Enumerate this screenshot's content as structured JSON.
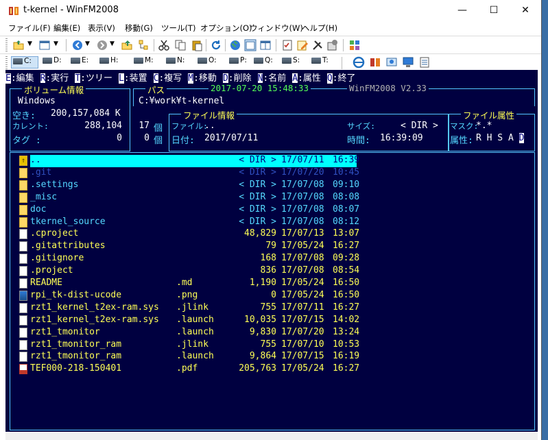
{
  "window": {
    "title": "t-kernel - WinFM2008",
    "min": "—",
    "max": "☐",
    "close": "✕"
  },
  "menu": [
    "ファイル(F)",
    "編集(E)",
    "表示(V)",
    "移動(G)",
    "ツール(T)",
    "オプション(O)",
    "ウィンドウ(W)",
    "ヘルプ(H)"
  ],
  "drives": [
    "C:",
    "D:",
    "E:",
    "H:",
    "M:",
    "N:",
    "O:",
    "P:",
    "Q:",
    "S:",
    "T:"
  ],
  "commands": [
    {
      "key": "E",
      "label": ":編集"
    },
    {
      "key": "R",
      "label": ":実行"
    },
    {
      "key": "T",
      "label": ":ツリー"
    },
    {
      "key": "L",
      "label": ":装置"
    },
    {
      "key": "C",
      "label": ":複写"
    },
    {
      "key": "M",
      "label": ":移動"
    },
    {
      "key": "D",
      "label": ":削除"
    },
    {
      "key": "N",
      "label": ":名前"
    },
    {
      "key": "A",
      "label": ":属性"
    },
    {
      "key": "Q",
      "label": ":終了"
    }
  ],
  "volume": {
    "legend": "ボリューム情報",
    "name": "Windows",
    "free_label": "空き:",
    "free_value": "200,157,084 K",
    "current_label": "カレント:",
    "current_size": "288,104",
    "current_count": "17",
    "count_unit": "個",
    "tag_label": "タグ :",
    "tag_size": "0",
    "tag_count": "0"
  },
  "path": {
    "legend": "パス",
    "datetime": "2017-07-20 15:48:33",
    "version": "WinFM2008 V2.33",
    "value": "C:¥work¥t-kernel"
  },
  "fileinfo": {
    "legend": "ファイル情報",
    "file_label": "ファイル:",
    "file_value": "..",
    "size_label": "サイズ:",
    "size_value": "< DIR >",
    "date_label": "日付:",
    "date_value": "2017/07/11",
    "time_label": "時間:",
    "time_value": "16:39:09"
  },
  "attr": {
    "legend": "ファイル属性",
    "mask_label": "マスク:",
    "mask_value": "*.*",
    "attr_label": "属性:",
    "attr_value": "R H S A ",
    "attr_highlight": "D"
  },
  "files": [
    {
      "name": "..",
      "ext": "",
      "size": "< DIR >",
      "date": "17/07/11",
      "time": "16:39",
      "type": "up",
      "color": "sel"
    },
    {
      "name": ".git",
      "ext": "",
      "size": "< DIR >",
      "date": "17/07/20",
      "time": "10:45",
      "type": "folder",
      "color": "hidden"
    },
    {
      "name": ".settings",
      "ext": "",
      "size": "< DIR >",
      "date": "17/07/08",
      "time": "09:10",
      "type": "folder",
      "color": "cyan"
    },
    {
      "name": "_misc",
      "ext": "",
      "size": "< DIR >",
      "date": "17/07/08",
      "time": "08:08",
      "type": "folder",
      "color": "cyan"
    },
    {
      "name": "doc",
      "ext": "",
      "size": "< DIR >",
      "date": "17/07/08",
      "time": "08:07",
      "type": "folder",
      "color": "cyan"
    },
    {
      "name": "tkernel_source",
      "ext": "",
      "size": "< DIR >",
      "date": "17/07/08",
      "time": "08:12",
      "type": "folder",
      "color": "cyan"
    },
    {
      "name": ".cproject",
      "ext": "",
      "size": "48,829",
      "date": "17/07/13",
      "time": "13:07",
      "type": "doc",
      "color": "yellow"
    },
    {
      "name": ".gitattributes",
      "ext": "",
      "size": "79",
      "date": "17/05/24",
      "time": "16:27",
      "type": "doc",
      "color": "yellow"
    },
    {
      "name": ".gitignore",
      "ext": "",
      "size": "168",
      "date": "17/07/08",
      "time": "09:28",
      "type": "doc",
      "color": "yellow"
    },
    {
      "name": ".project",
      "ext": "",
      "size": "836",
      "date": "17/07/08",
      "time": "08:54",
      "type": "doc",
      "color": "yellow"
    },
    {
      "name": "README",
      "ext": ".md",
      "size": "1,190",
      "date": "17/05/24",
      "time": "16:50",
      "type": "doc",
      "color": "yellow"
    },
    {
      "name": "rpi_tk-dist-ucode",
      "ext": ".png",
      "size": "0",
      "date": "17/05/24",
      "time": "16:50",
      "type": "image",
      "color": "yellow"
    },
    {
      "name": "rzt1_kernel_t2ex-ram.sys",
      "ext": ".jlink",
      "size": "755",
      "date": "17/07/11",
      "time": "16:27",
      "type": "doc",
      "color": "yellow"
    },
    {
      "name": "rzt1_kernel_t2ex-ram.sys",
      "ext": ".launch",
      "size": "10,035",
      "date": "17/07/15",
      "time": "14:02",
      "type": "doc",
      "color": "yellow"
    },
    {
      "name": "rzt1_tmonitor",
      "ext": ".launch",
      "size": "9,830",
      "date": "17/07/20",
      "time": "13:24",
      "type": "doc",
      "color": "yellow"
    },
    {
      "name": "rzt1_tmonitor_ram",
      "ext": ".jlink",
      "size": "755",
      "date": "17/07/10",
      "time": "10:53",
      "type": "doc",
      "color": "yellow"
    },
    {
      "name": "rzt1_tmonitor_ram",
      "ext": ".launch",
      "size": "9,864",
      "date": "17/07/15",
      "time": "16:19",
      "type": "doc",
      "color": "yellow"
    },
    {
      "name": "TEF000-218-150401",
      "ext": ".pdf",
      "size": "205,763",
      "date": "17/05/24",
      "time": "16:27",
      "type": "pdf",
      "color": "yellow"
    }
  ],
  "colors": {
    "console_bg": "#000040",
    "frame": "#55c8ff",
    "selection": "#00ffff",
    "folder_text": "#55d8ff",
    "file_text": "#ffff55",
    "hidden_text": "#3050c0"
  }
}
